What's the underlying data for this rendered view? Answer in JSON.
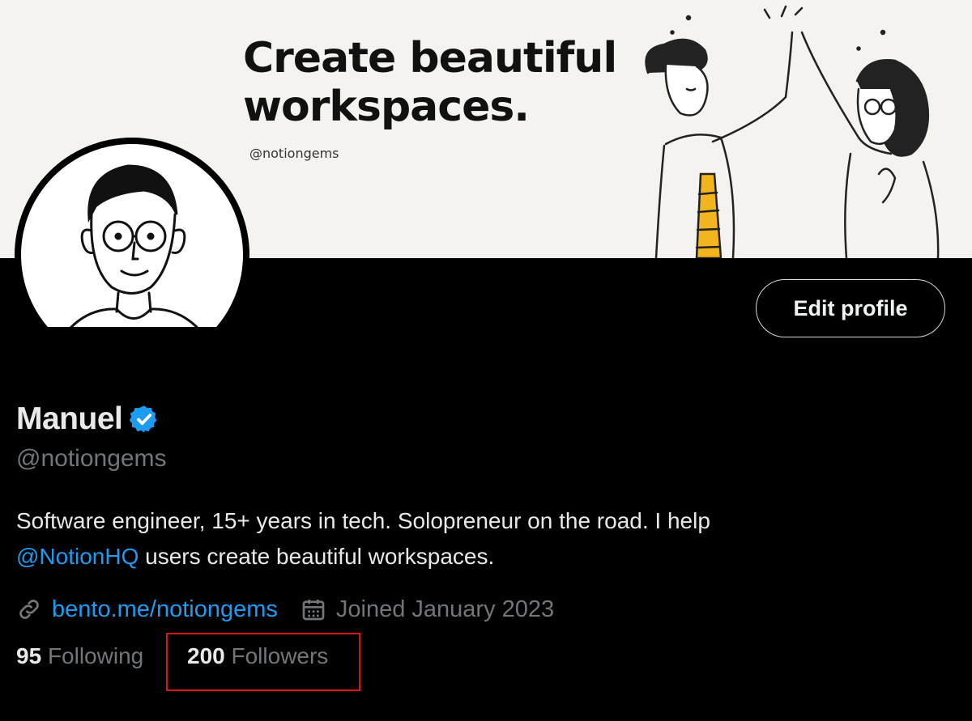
{
  "banner": {
    "headline_line1": "Create beautiful",
    "headline_line2": "workspaces.",
    "handle": "@notiongems"
  },
  "profile": {
    "edit_button_label": "Edit profile",
    "display_name": "Manuel",
    "verified": true,
    "handle": "@notiongems",
    "bio_text": "Software engineer, 15+ years in tech. Solopreneur on the road. I help ",
    "bio_mention": "@NotionHQ",
    "bio_text_after": " users create beautiful workspaces.",
    "website": "bento.me/notiongems",
    "joined": "Joined January 2023",
    "following_count": "95",
    "following_label": "Following",
    "followers_count": "200",
    "followers_label": "Followers"
  },
  "icons": {
    "link": "link-icon",
    "calendar": "calendar-icon",
    "verified": "verified-badge-icon"
  },
  "colors": {
    "accent": "#1d9bf0",
    "muted": "#71767b",
    "highlight": "#e01010"
  }
}
